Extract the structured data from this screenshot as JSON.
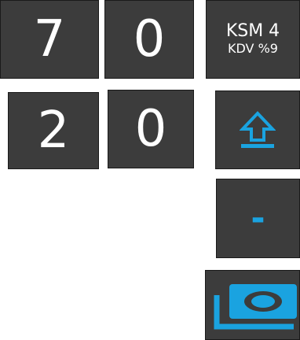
{
  "keypad": {
    "row1": {
      "digit_a": "7",
      "digit_b": "0"
    },
    "row2": {
      "digit_a": "2",
      "digit_b": "0"
    }
  },
  "ksm_key": {
    "title": "KSM 4",
    "subtitle": "KDV %9"
  },
  "shift_key": {
    "icon": "arrow-up-icon"
  },
  "minus_key": {
    "label": "-"
  },
  "cash_key": {
    "icon": "banknotes-icon"
  },
  "colors": {
    "key_background": "#3c3c3c",
    "accent": "#1aa3e0",
    "text": "#ffffff"
  }
}
